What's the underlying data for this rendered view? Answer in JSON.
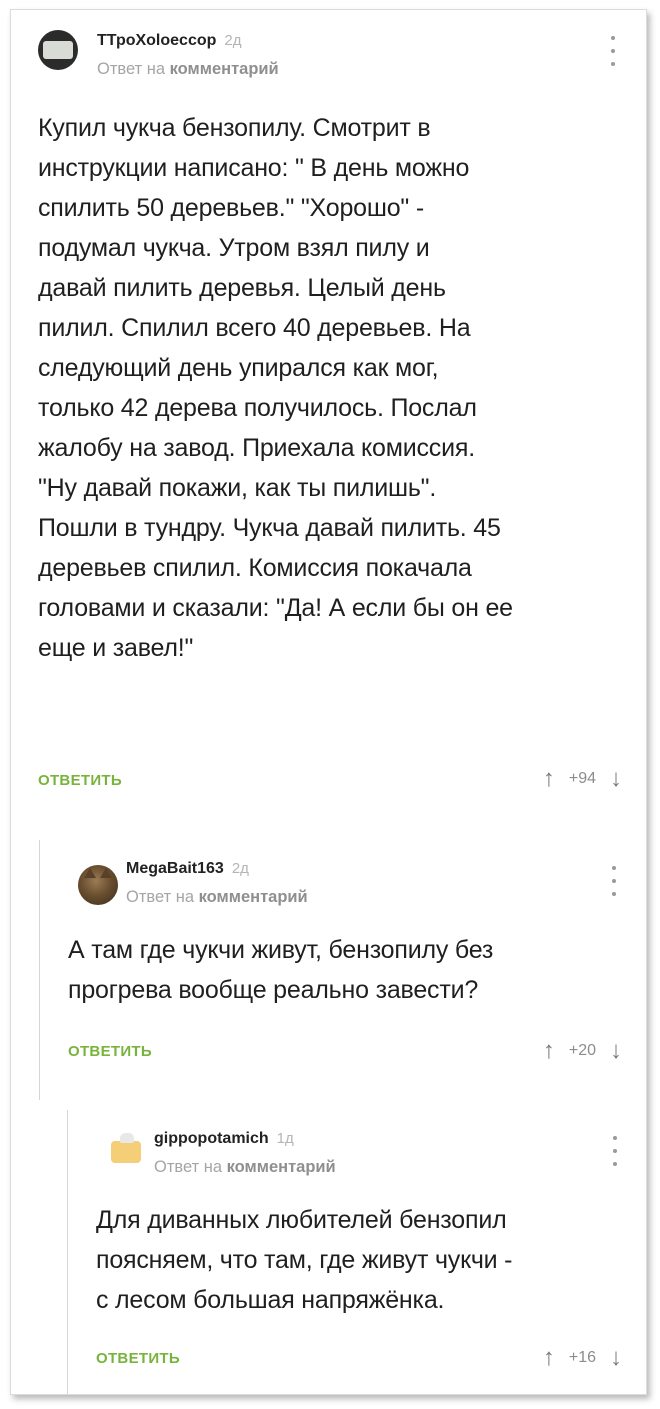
{
  "comments": [
    {
      "username": "ТТроXoloeccop",
      "age": "2д",
      "reply_prefix": "Ответ на",
      "reply_link": "комментарий",
      "text": "Купил чукча бензопилу. Смотрит в\nинструкции написано: \" В день можно\nспилить 50 деревьев.\" \"Хорошо\" -\nподумал чукча. Утром взял пилу и\nдавай пилить деревья. Целый день\nпилил. Спилил всего 40 деревьев. На\nследующий день упирался как мог,\nтолько 42 дерева получилось. Послал\nжалобу на завод. Приехала комиссия.\n\"Ну давай покажи, как ты пилишь\".\nПошли в тундру. Чукча давай пилить. 45\nдеревьев спилил. Комиссия покачала\nголовами и сказали: \"Да! А если бы он ее\nеще и завел!\"",
      "reply_label": "ОТВЕТИТЬ",
      "score": "+94"
    },
    {
      "username": "MegaBait163",
      "age": "2д",
      "reply_prefix": "Ответ на",
      "reply_link": "комментарий",
      "text": "А там где чукчи живут, бензопилу без\nпрогрева вообще реально завести?",
      "reply_label": "ОТВЕТИТЬ",
      "score": "+20"
    },
    {
      "username": "gippopotamich",
      "age": "1д",
      "reply_prefix": "Ответ на",
      "reply_link": "комментарий",
      "text": "Для диванных любителей бензопил\nпоясняем, что там, где живут чукчи -\nс лесом большая напряжёнка.",
      "reply_label": "ОТВЕТИТЬ",
      "score": "+16"
    }
  ],
  "icons": {
    "upvote": "arrow-up-icon",
    "downvote": "arrow-down-icon",
    "menu": "more-vertical-icon"
  },
  "colors": {
    "reply_button": "#78b43c",
    "meta_text": "#a5a5a5",
    "body_text": "#1f1f1f"
  }
}
